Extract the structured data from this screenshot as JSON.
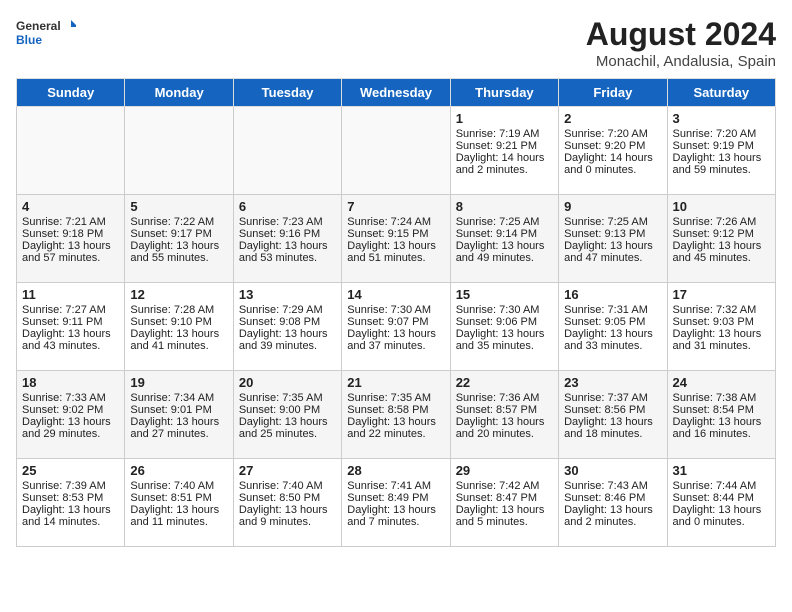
{
  "header": {
    "logo_line1": "General",
    "logo_line2": "Blue",
    "main_title": "August 2024",
    "subtitle": "Monachil, Andalusia, Spain"
  },
  "days_of_week": [
    "Sunday",
    "Monday",
    "Tuesday",
    "Wednesday",
    "Thursday",
    "Friday",
    "Saturday"
  ],
  "weeks": [
    [
      {
        "day": "",
        "content": ""
      },
      {
        "day": "",
        "content": ""
      },
      {
        "day": "",
        "content": ""
      },
      {
        "day": "",
        "content": ""
      },
      {
        "day": "1",
        "content": "Sunrise: 7:19 AM\nSunset: 9:21 PM\nDaylight: 14 hours\nand 2 minutes."
      },
      {
        "day": "2",
        "content": "Sunrise: 7:20 AM\nSunset: 9:20 PM\nDaylight: 14 hours\nand 0 minutes."
      },
      {
        "day": "3",
        "content": "Sunrise: 7:20 AM\nSunset: 9:19 PM\nDaylight: 13 hours\nand 59 minutes."
      }
    ],
    [
      {
        "day": "4",
        "content": "Sunrise: 7:21 AM\nSunset: 9:18 PM\nDaylight: 13 hours\nand 57 minutes."
      },
      {
        "day": "5",
        "content": "Sunrise: 7:22 AM\nSunset: 9:17 PM\nDaylight: 13 hours\nand 55 minutes."
      },
      {
        "day": "6",
        "content": "Sunrise: 7:23 AM\nSunset: 9:16 PM\nDaylight: 13 hours\nand 53 minutes."
      },
      {
        "day": "7",
        "content": "Sunrise: 7:24 AM\nSunset: 9:15 PM\nDaylight: 13 hours\nand 51 minutes."
      },
      {
        "day": "8",
        "content": "Sunrise: 7:25 AM\nSunset: 9:14 PM\nDaylight: 13 hours\nand 49 minutes."
      },
      {
        "day": "9",
        "content": "Sunrise: 7:25 AM\nSunset: 9:13 PM\nDaylight: 13 hours\nand 47 minutes."
      },
      {
        "day": "10",
        "content": "Sunrise: 7:26 AM\nSunset: 9:12 PM\nDaylight: 13 hours\nand 45 minutes."
      }
    ],
    [
      {
        "day": "11",
        "content": "Sunrise: 7:27 AM\nSunset: 9:11 PM\nDaylight: 13 hours\nand 43 minutes."
      },
      {
        "day": "12",
        "content": "Sunrise: 7:28 AM\nSunset: 9:10 PM\nDaylight: 13 hours\nand 41 minutes."
      },
      {
        "day": "13",
        "content": "Sunrise: 7:29 AM\nSunset: 9:08 PM\nDaylight: 13 hours\nand 39 minutes."
      },
      {
        "day": "14",
        "content": "Sunrise: 7:30 AM\nSunset: 9:07 PM\nDaylight: 13 hours\nand 37 minutes."
      },
      {
        "day": "15",
        "content": "Sunrise: 7:30 AM\nSunset: 9:06 PM\nDaylight: 13 hours\nand 35 minutes."
      },
      {
        "day": "16",
        "content": "Sunrise: 7:31 AM\nSunset: 9:05 PM\nDaylight: 13 hours\nand 33 minutes."
      },
      {
        "day": "17",
        "content": "Sunrise: 7:32 AM\nSunset: 9:03 PM\nDaylight: 13 hours\nand 31 minutes."
      }
    ],
    [
      {
        "day": "18",
        "content": "Sunrise: 7:33 AM\nSunset: 9:02 PM\nDaylight: 13 hours\nand 29 minutes."
      },
      {
        "day": "19",
        "content": "Sunrise: 7:34 AM\nSunset: 9:01 PM\nDaylight: 13 hours\nand 27 minutes."
      },
      {
        "day": "20",
        "content": "Sunrise: 7:35 AM\nSunset: 9:00 PM\nDaylight: 13 hours\nand 25 minutes."
      },
      {
        "day": "21",
        "content": "Sunrise: 7:35 AM\nSunset: 8:58 PM\nDaylight: 13 hours\nand 22 minutes."
      },
      {
        "day": "22",
        "content": "Sunrise: 7:36 AM\nSunset: 8:57 PM\nDaylight: 13 hours\nand 20 minutes."
      },
      {
        "day": "23",
        "content": "Sunrise: 7:37 AM\nSunset: 8:56 PM\nDaylight: 13 hours\nand 18 minutes."
      },
      {
        "day": "24",
        "content": "Sunrise: 7:38 AM\nSunset: 8:54 PM\nDaylight: 13 hours\nand 16 minutes."
      }
    ],
    [
      {
        "day": "25",
        "content": "Sunrise: 7:39 AM\nSunset: 8:53 PM\nDaylight: 13 hours\nand 14 minutes."
      },
      {
        "day": "26",
        "content": "Sunrise: 7:40 AM\nSunset: 8:51 PM\nDaylight: 13 hours\nand 11 minutes."
      },
      {
        "day": "27",
        "content": "Sunrise: 7:40 AM\nSunset: 8:50 PM\nDaylight: 13 hours\nand 9 minutes."
      },
      {
        "day": "28",
        "content": "Sunrise: 7:41 AM\nSunset: 8:49 PM\nDaylight: 13 hours\nand 7 minutes."
      },
      {
        "day": "29",
        "content": "Sunrise: 7:42 AM\nSunset: 8:47 PM\nDaylight: 13 hours\nand 5 minutes."
      },
      {
        "day": "30",
        "content": "Sunrise: 7:43 AM\nSunset: 8:46 PM\nDaylight: 13 hours\nand 2 minutes."
      },
      {
        "day": "31",
        "content": "Sunrise: 7:44 AM\nSunset: 8:44 PM\nDaylight: 13 hours\nand 0 minutes."
      }
    ]
  ]
}
